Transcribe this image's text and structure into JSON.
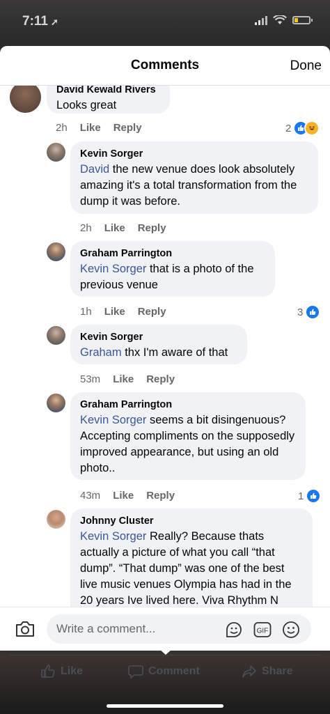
{
  "status": {
    "time": "7:11"
  },
  "header": {
    "title": "Comments",
    "done": "Done"
  },
  "comments": [
    {
      "author": "David Kewald Rivers",
      "text": "Looks great",
      "time": "2h",
      "like": "Like",
      "reply": "Reply",
      "reactions": "2"
    },
    {
      "author": "Kevin Sorger",
      "mention": "David",
      "text": " the new venue does look absolutely amazing it's a total transformation from the dump it was before.",
      "time": "2h",
      "like": "Like",
      "reply": "Reply"
    },
    {
      "author": "Graham Parrington",
      "mention": "Kevin Sorger",
      "text": " that is a photo of the previous venue",
      "time": "1h",
      "like": "Like",
      "reply": "Reply",
      "reactions": "3"
    },
    {
      "author": "Kevin Sorger",
      "mention": "Graham",
      "text": " thx I'm aware of that",
      "time": "53m",
      "like": "Like",
      "reply": "Reply"
    },
    {
      "author": "Graham Parrington",
      "mention": "Kevin Sorger",
      "text": " seems a bit disingenuous? Accepting compliments on the supposedly improved appearance, but using an old photo..",
      "time": "43m",
      "like": "Like",
      "reply": "Reply",
      "reactions": "1"
    },
    {
      "author": "Johnny Cluster",
      "mention": "Kevin Sorger",
      "text": " Really? Because thats actually a picture of what you call “that dump”. “That dump” was one of the best live music venues Olympia has had in the 20 years Ive lived here. Viva Rhythm N"
    }
  ],
  "composer": {
    "placeholder": "Write a comment..."
  },
  "bottom_bar": {
    "like": "Like",
    "comment": "Comment",
    "share": "Share"
  },
  "colors": {
    "mention": "#385898",
    "like_blue": "#1877f2",
    "bubble": "#f0f2f5"
  }
}
